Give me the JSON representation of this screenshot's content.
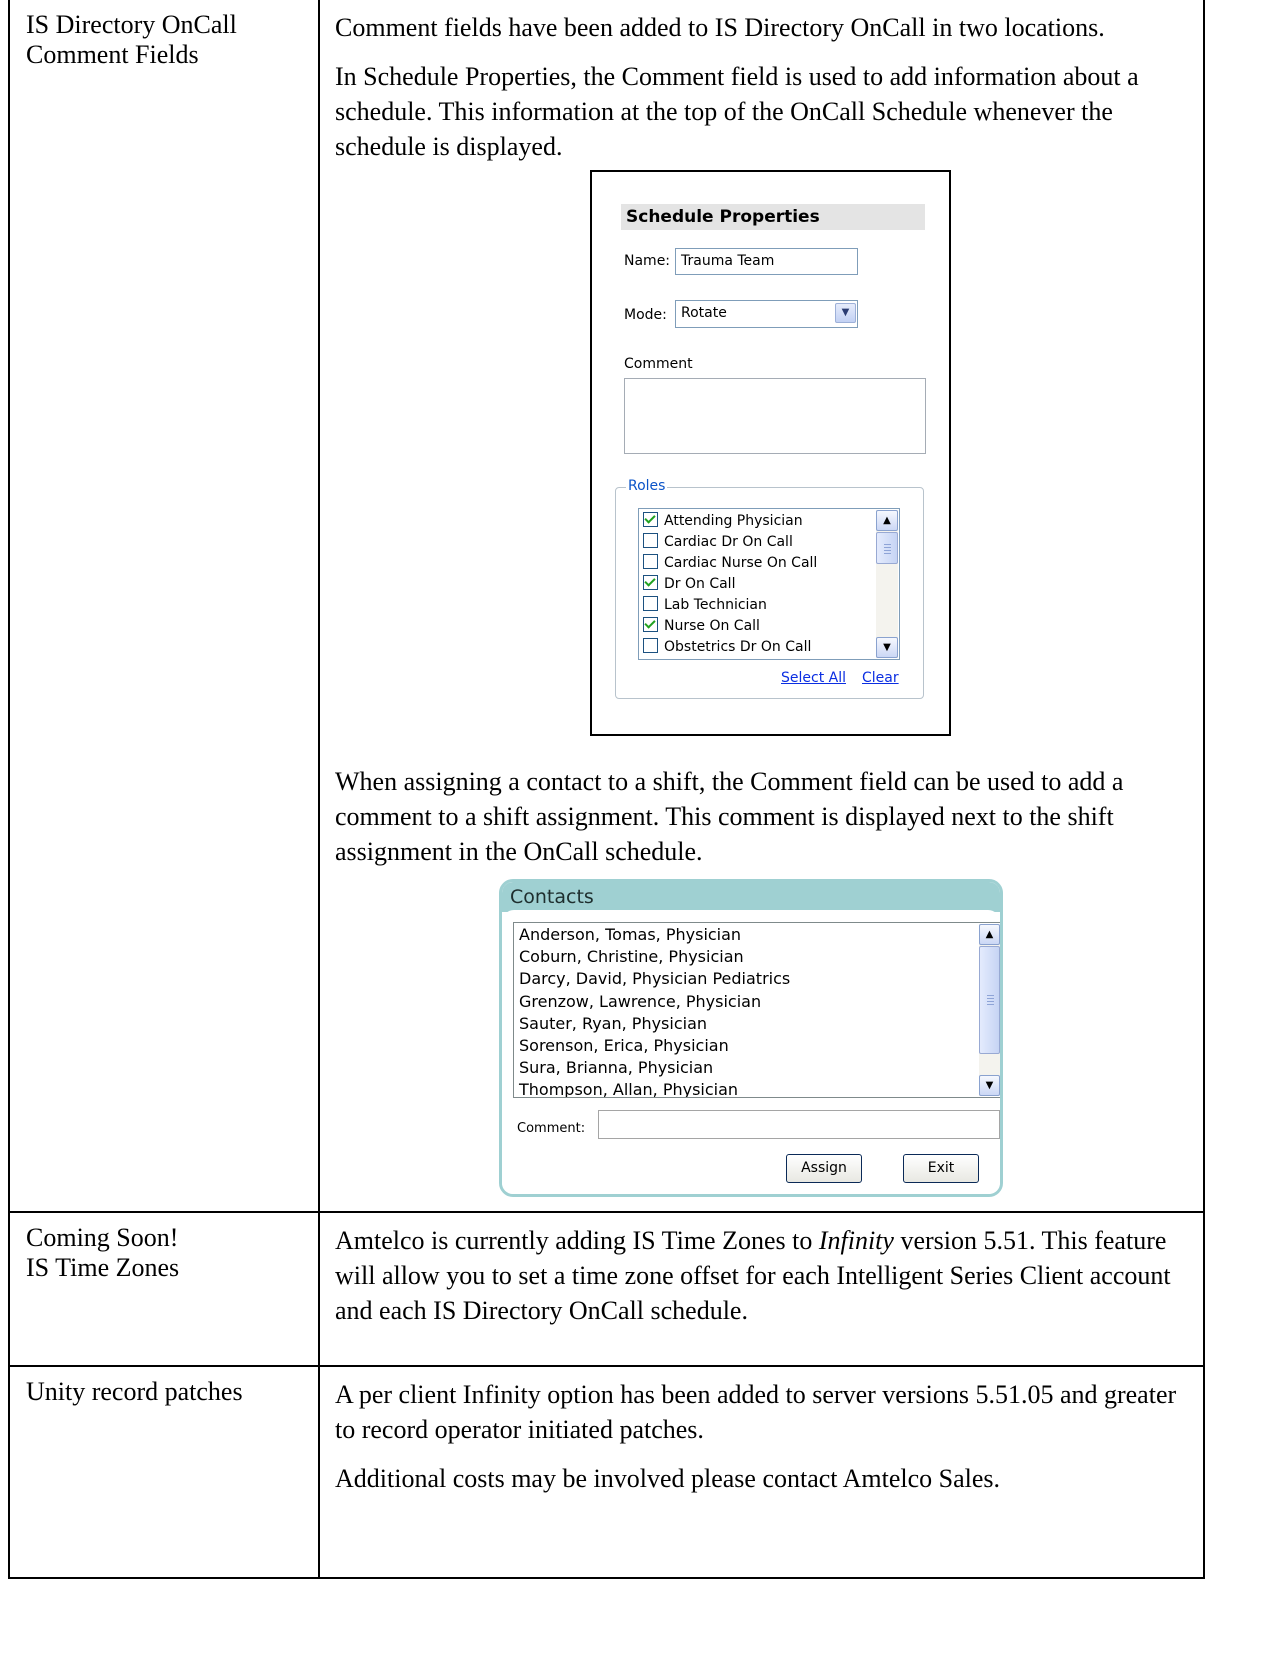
{
  "rows": [
    {
      "label_lines": [
        "IS Directory OnCall",
        "Comment Fields"
      ],
      "paragraphs": [
        "Comment fields have been added to IS Directory OnCall in two locations.",
        "In Schedule Properties, the Comment field is used to add information about a schedule. This information at the top of the OnCall Schedule whenever the schedule is displayed.",
        "When assigning a contact to a shift, the Comment field can be used to add a comment to a shift assignment. This comment is displayed next to the shift assignment in the OnCall schedule."
      ]
    },
    {
      "label_lines": [
        "Coming Soon!",
        "IS Time Zones"
      ],
      "paragraph_parts": [
        "Amtelco is currently adding IS Time Zones to ",
        "Infinity",
        " version 5.51. This feature will allow you to set a time zone offset for each Intelligent Series Client account and each IS Directory OnCall schedule."
      ]
    },
    {
      "label_lines": [
        "Unity record patches"
      ],
      "paragraphs": [
        "A per client Infinity option has been added to server versions 5.51.05 and greater to record operator initiated patches.",
        "Additional costs may be involved please contact Amtelco Sales."
      ]
    }
  ],
  "schedule_properties": {
    "title": "Schedule Properties",
    "name_label": "Name:",
    "name_value": "Trauma Team",
    "mode_label": "Mode:",
    "mode_value": "Rotate",
    "comment_label": "Comment",
    "comment_value": "",
    "roles_legend": "Roles",
    "roles": [
      {
        "label": "Attending Physician",
        "checked": true
      },
      {
        "label": "Cardiac Dr On Call",
        "checked": false
      },
      {
        "label": "Cardiac Nurse On Call",
        "checked": false
      },
      {
        "label": "Dr On Call",
        "checked": true
      },
      {
        "label": "Lab Technician",
        "checked": false
      },
      {
        "label": "Nurse On Call",
        "checked": true
      },
      {
        "label": "Obstetrics Dr On Call",
        "checked": false
      }
    ],
    "select_all_label": "Select All",
    "clear_label": "Clear",
    "icons": {
      "dropdown": "chevron-down-icon",
      "scroll_up": "chevron-up-icon",
      "scroll_down": "chevron-down-icon"
    }
  },
  "contacts_panel": {
    "title": "Contacts",
    "contacts": [
      "Anderson, Tomas, Physician",
      "Coburn, Christine, Physician",
      "Darcy, David, Physician Pediatrics",
      "Grenzow, Lawrence, Physician",
      "Sauter, Ryan, Physician",
      "Sorenson, Erica, Physician",
      "Sura, Brianna, Physician",
      "Thompson, Allan, Physician"
    ],
    "comment_label": "Comment:",
    "comment_value": "",
    "assign_label": "Assign",
    "exit_label": "Exit",
    "accent_color": "#9fd0d2"
  },
  "colors": {
    "link": "#0b2ee2",
    "roles_legend": "#0b54c8",
    "checkmark": "#21a121"
  }
}
